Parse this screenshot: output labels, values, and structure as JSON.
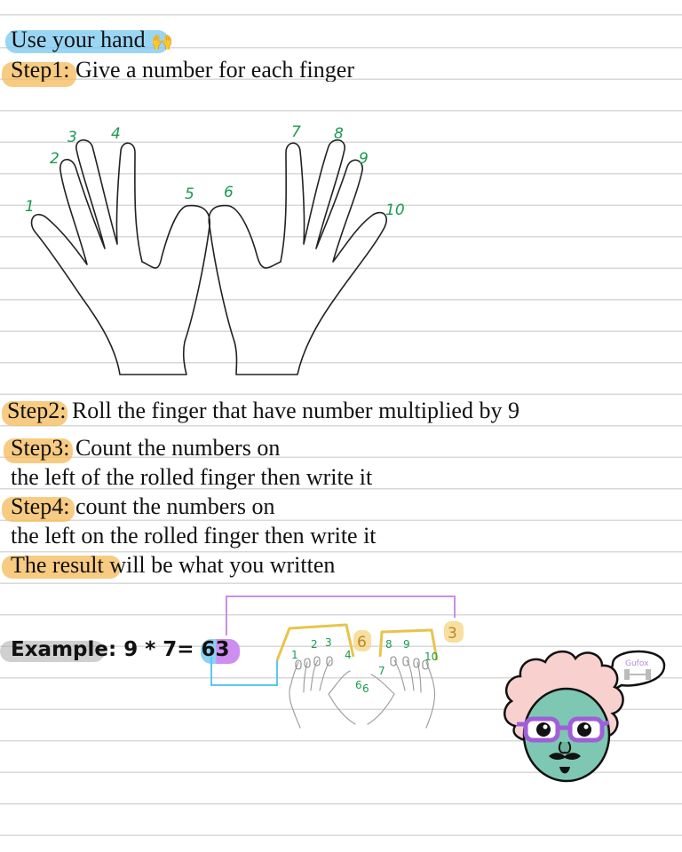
{
  "title": {
    "text": "Use your hand",
    "emoji": "🙌"
  },
  "steps": [
    {
      "label": "Step1",
      "text": ": Give a number for each finger"
    },
    {
      "label": "Step2",
      "text": ": Roll the finger that have number multiplied by 9"
    },
    {
      "label": "Step3",
      "text": ": Count the numbers on",
      "text2": "the left of the rolled finger then write it"
    },
    {
      "label": "Step4",
      "text": ": count the numbers on",
      "text2": "the left on the rolled finger then write it"
    }
  ],
  "result": {
    "label": "The result",
    "text": " will be what you written"
  },
  "finger_numbers": [
    "1",
    "2",
    "3",
    "4",
    "5",
    "6",
    "7",
    "8",
    "9",
    "10"
  ],
  "example": {
    "label": "Example",
    "expression": ": 9 * 7= ",
    "answer": "63",
    "left_count": "6",
    "right_count": "3",
    "small_numbers": [
      "1",
      "2",
      "3",
      "4",
      "6",
      "6",
      "7",
      "8",
      "9",
      "10"
    ]
  },
  "mascot": {
    "bubble_text": "Gufox",
    "bubble_icon": "dumbbell-icon"
  },
  "colors": {
    "highlight_blue": "#78c8f0",
    "highlight_orange": "#f5b95a",
    "highlight_purple": "#c882f0",
    "finger_number_green": "#1a9a52",
    "bracket_yellow": "#e8c44c",
    "connector_purple": "#c98ee6",
    "connector_blue": "#5cc8ec"
  }
}
